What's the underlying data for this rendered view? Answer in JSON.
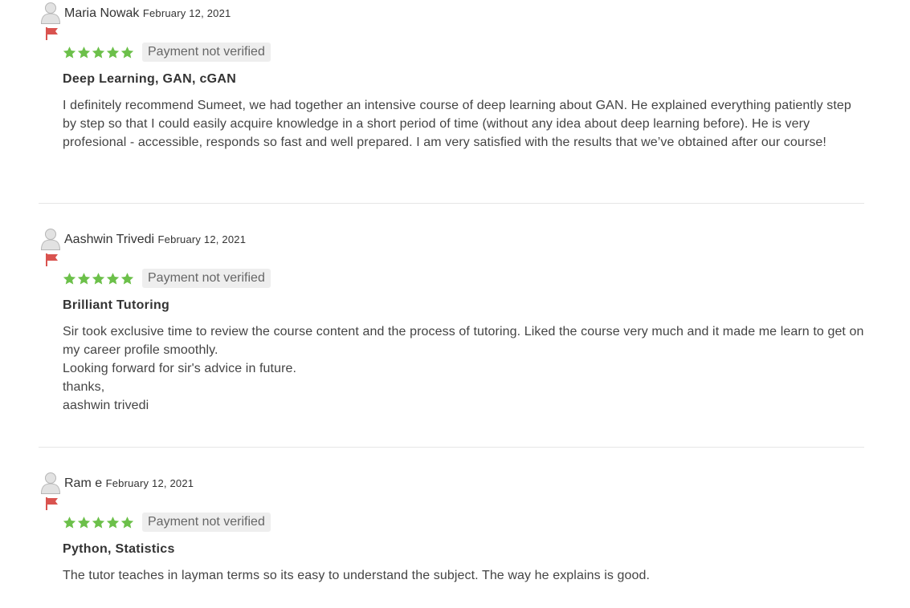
{
  "colors": {
    "star": "#6cc04a",
    "flag": "#d9534f",
    "badge_bg": "#eeeeee",
    "divider": "#e6e6e6"
  },
  "icons": {
    "avatar": "user-silhouette-icon",
    "flag": "report-flag-icon",
    "star": "star-icon"
  },
  "reviews": [
    {
      "name": "Maria Nowak",
      "date": "February 12, 2021",
      "rating": 5,
      "badge": "Payment not verified",
      "title": "Deep Learning, GAN, cGAN",
      "body": [
        "I definitely recommend Sumeet, we had together an intensive course of deep learning about GAN. He explained everything patiently step by step so that I could easily acquire knowledge in a short period of time (without any idea about deep learning before). He is very profesional - accessible, responds so fast and well prepared. I am very satisfied with the results that we’ve obtained after our course!"
      ]
    },
    {
      "name": "Aashwin Trivedi",
      "date": "February 12, 2021",
      "rating": 5,
      "badge": "Payment not verified",
      "title": "Brilliant Tutoring",
      "body": [
        "Sir took exclusive time to review the course content and the process of tutoring. Liked the course very much and it made me learn to get on my career profile smoothly.",
        "Looking forward for sir's advice in future.",
        "thanks,",
        "aashwin trivedi"
      ]
    },
    {
      "name": "Ram e",
      "date": "February 12, 2021",
      "rating": 5,
      "badge": "Payment not verified",
      "title": "Python, Statistics",
      "body": [
        "The tutor teaches in layman terms so its easy to understand the subject. The way he explains is good."
      ]
    }
  ]
}
